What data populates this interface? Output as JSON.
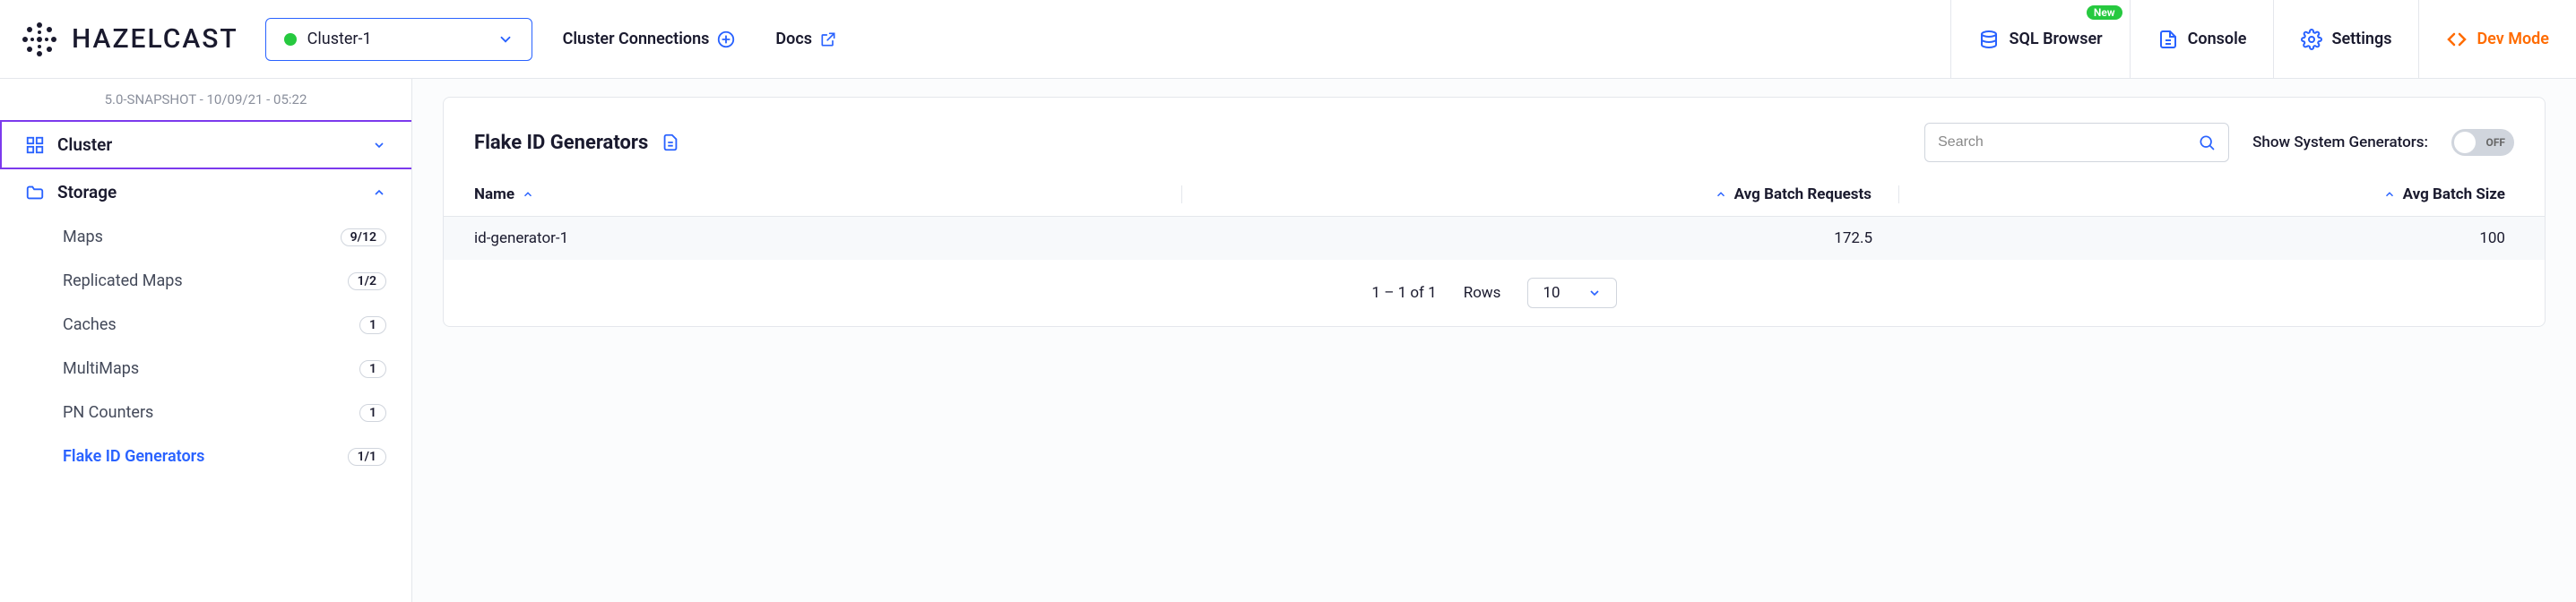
{
  "header": {
    "logo_text": "HAZELCAST",
    "cluster_selector": "Cluster-1",
    "links": {
      "connections": "Cluster Connections",
      "docs": "Docs"
    },
    "tools": {
      "sql": "SQL Browser",
      "sql_badge": "New",
      "console": "Console",
      "settings": "Settings",
      "dev": "Dev Mode"
    }
  },
  "sidebar": {
    "snapshot": "5.0-SNAPSHOT - 10/09/21 - 05:22",
    "cluster_label": "Cluster",
    "storage_label": "Storage",
    "items": [
      {
        "label": "Maps",
        "badge": "9/12"
      },
      {
        "label": "Replicated Maps",
        "badge": "1/2"
      },
      {
        "label": "Caches",
        "badge": "1"
      },
      {
        "label": "MultiMaps",
        "badge": "1"
      },
      {
        "label": "PN Counters",
        "badge": "1"
      },
      {
        "label": "Flake ID Generators",
        "badge": "1/1"
      }
    ]
  },
  "panel": {
    "title": "Flake ID Generators",
    "search_placeholder": "Search",
    "show_sys_label": "Show System Generators:",
    "toggle_state": "OFF"
  },
  "table": {
    "columns": {
      "name": "Name",
      "avg_req": "Avg Batch Requests",
      "avg_size": "Avg Batch Size"
    },
    "rows": [
      {
        "name": "id-generator-1",
        "avg_req": "172.5",
        "avg_size": "100"
      }
    ],
    "pagination": "1 – 1 of 1",
    "rows_label": "Rows",
    "rows_value": "10"
  }
}
